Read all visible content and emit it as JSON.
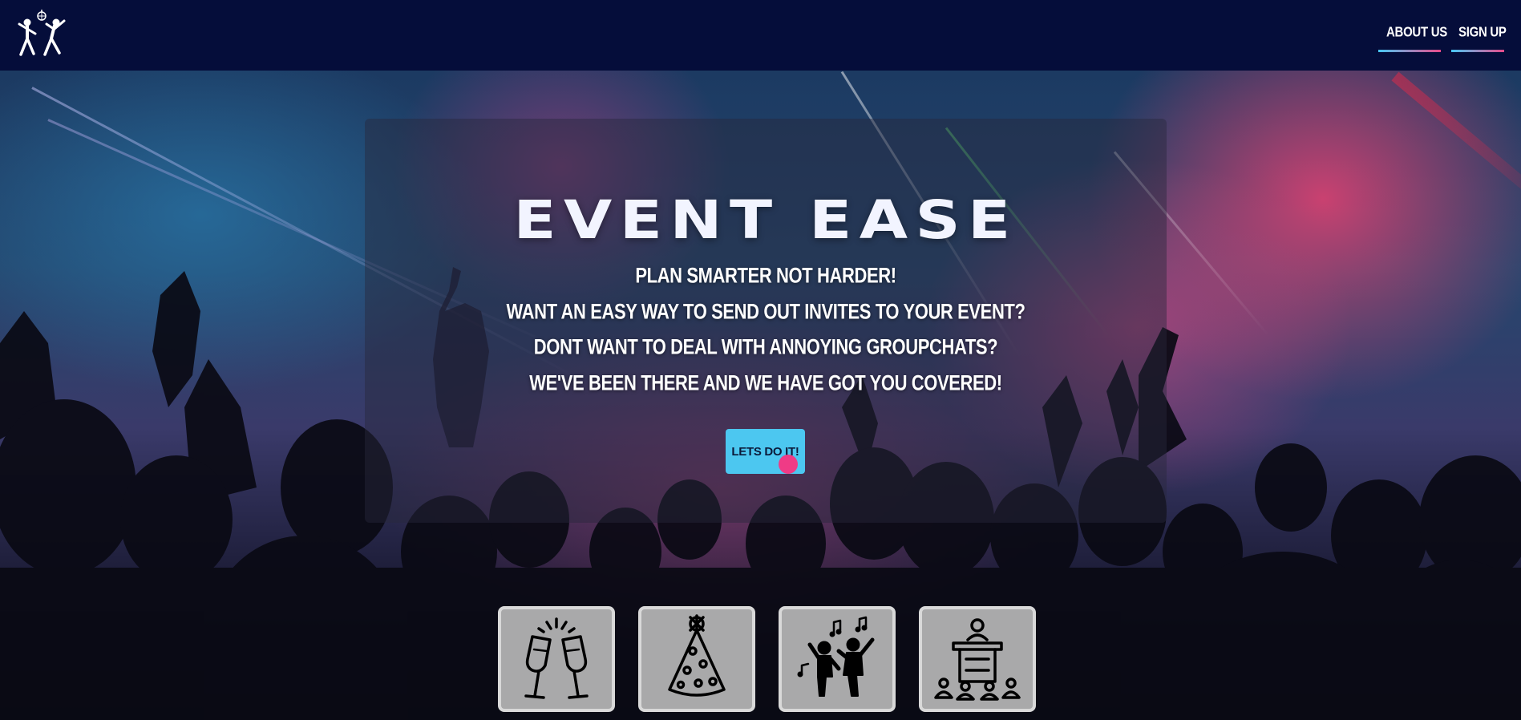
{
  "nav": {
    "logo": "dancing-people-disco-ball-logo",
    "links": [
      {
        "label": "ABOUT US"
      },
      {
        "label": "SIGN UP"
      }
    ]
  },
  "hero": {
    "title": "EVENT EASE",
    "taglines": [
      "PLAN SMARTER NOT HARDER!",
      "WANT AN EASY WAY TO SEND OUT INVITES TO YOUR EVENT?",
      "DONT WANT TO DEAL WITH ANNOYING GROUPCHATS?",
      "WE'VE BEEN THERE AND WE HAVE GOT YOU COVERED!"
    ],
    "cta_label": "LETS DO IT!",
    "background": "concert-crowd-photo"
  },
  "categories": [
    {
      "icon": "champagne-toast-icon"
    },
    {
      "icon": "party-hat-icon"
    },
    {
      "icon": "dancing-people-icon"
    },
    {
      "icon": "conference-podium-icon"
    }
  ],
  "colors": {
    "navbar": "#050d3a",
    "accent_blue": "#4cc7f0",
    "accent_pink": "#e84a8a",
    "cursor": "#ef3b86"
  }
}
